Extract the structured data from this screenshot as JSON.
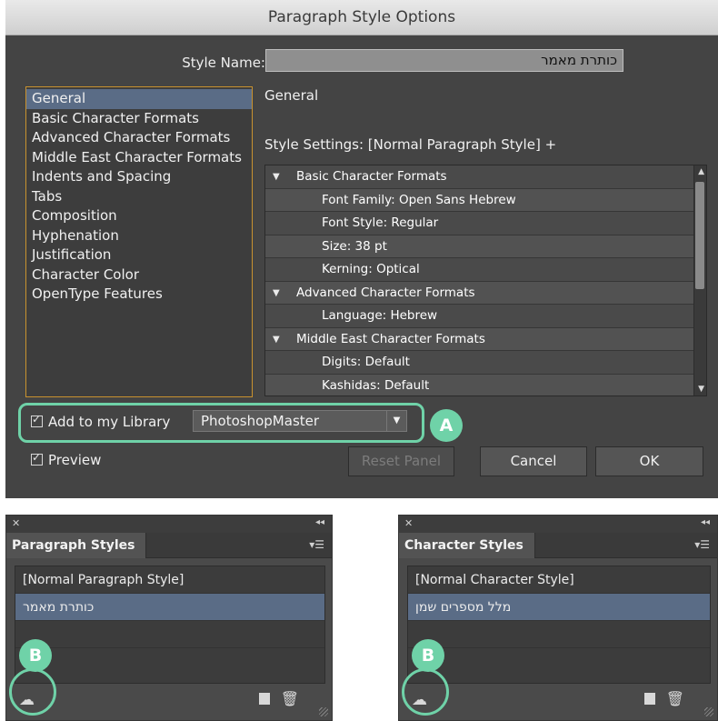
{
  "dialog": {
    "title": "Paragraph Style Options",
    "style_name_label": "Style Name:",
    "style_name_value": "כותרת מאמר",
    "categories": [
      {
        "label": "General",
        "selected": true
      },
      {
        "label": "Basic Character Formats"
      },
      {
        "label": "Advanced Character Formats"
      },
      {
        "label": "Middle East Character Formats"
      },
      {
        "label": "Indents and Spacing"
      },
      {
        "label": "Tabs"
      },
      {
        "label": "Composition"
      },
      {
        "label": "Hyphenation"
      },
      {
        "label": "Justification"
      },
      {
        "label": "Character Color"
      },
      {
        "label": "OpenType Features"
      }
    ],
    "section_title": "General",
    "style_settings": "Style Settings: [Normal Paragraph Style] +",
    "settings_rows": [
      {
        "text": "Basic Character Formats",
        "level": "head"
      },
      {
        "text": "Font Family: Open Sans Hebrew",
        "level": "sub"
      },
      {
        "text": "Font Style: Regular",
        "level": "sub"
      },
      {
        "text": "Size: 38 pt",
        "level": "sub"
      },
      {
        "text": "Kerning: Optical",
        "level": "sub"
      },
      {
        "text": "Advanced Character Formats",
        "level": "head"
      },
      {
        "text": "Language: Hebrew",
        "level": "sub"
      },
      {
        "text": "Middle East Character Formats",
        "level": "head"
      },
      {
        "text": "Digits: Default",
        "level": "sub"
      },
      {
        "text": "Kashidas: Default",
        "level": "sub"
      }
    ],
    "add_library_label": "Add to my Library",
    "library_value": "PhotoshopMaster",
    "preview_label": "Preview",
    "reset_label": "Reset Panel",
    "cancel_label": "Cancel",
    "ok_label": "OK"
  },
  "badges": {
    "a": "A",
    "b": "B"
  },
  "paragraph_panel": {
    "tab": "Paragraph Styles",
    "rows": [
      {
        "text": "[Normal Paragraph Style]",
        "selected": false,
        "rtl": false
      },
      {
        "text": "כותרת מאמר",
        "selected": true,
        "rtl": true
      }
    ]
  },
  "character_panel": {
    "tab": "Character Styles",
    "rows": [
      {
        "text": "[Normal Character Style]",
        "selected": false,
        "rtl": false
      },
      {
        "text": "מלל מספרים שמן",
        "selected": true,
        "rtl": true
      }
    ]
  },
  "colors": {
    "accent_highlight": "#6fd2a8",
    "selection": "#5a6c86",
    "list_border": "#c9922f"
  },
  "icons": [
    "close-icon",
    "collapse-icon",
    "panel-menu-icon",
    "creative-cloud-library-icon",
    "new-style-icon",
    "trash-icon",
    "dropdown-arrow-icon",
    "checkbox-checked-icon"
  ]
}
